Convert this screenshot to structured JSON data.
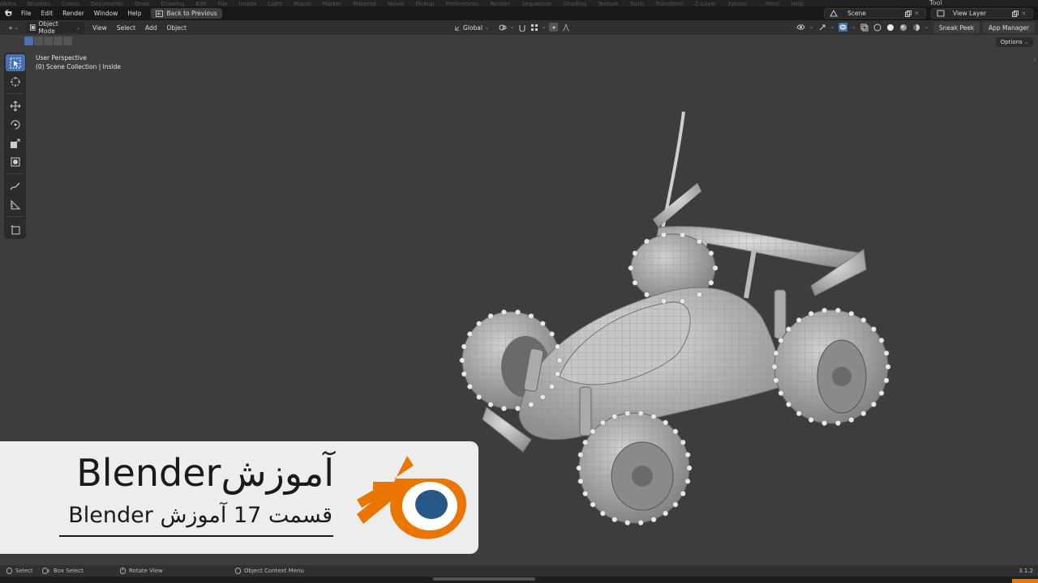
{
  "ghost_menu": [
    "Alpha",
    "Brushes",
    "Colors",
    "Documents",
    "Draw",
    "Drawing",
    "Edit",
    "File",
    "Image",
    "Light",
    "Macro",
    "Marker",
    "Material",
    "Movie",
    "Pickup",
    "Preferences",
    "Render",
    "Sequencer",
    "Shading",
    "Texture",
    "Tools",
    "Transform",
    "Z-Layer",
    "Xpress",
    "... More",
    "Help"
  ],
  "topbar": {
    "menu": [
      "File",
      "Edit",
      "Render",
      "Window",
      "Help"
    ],
    "back_label": "Back to Previous",
    "scene_label": "Scene",
    "view_layer_label": "View Layer",
    "tool_label": "Tool"
  },
  "header": {
    "mode_label": "Object Mode",
    "menu": [
      "View",
      "Select",
      "Add",
      "Object"
    ],
    "orientation_label": "Global",
    "sneak_peek_label": "Sneak Peek",
    "app_manager_label": "App Manager"
  },
  "viewport": {
    "options_label": "Options",
    "perspective_label": "User Perspective",
    "collection_label": "(0) Scene Collection | Inside"
  },
  "toolbar": {
    "tools": [
      "select-box-icon",
      "cursor-icon",
      "move-icon",
      "rotate-icon",
      "scale-icon",
      "transform-icon",
      "annotate-icon",
      "measure-icon",
      "add-cube-icon"
    ]
  },
  "banner": {
    "title": "آموزشBlender",
    "subtitle": "قسمت 17 آموزش Blender",
    "logo_colors": {
      "orange": "#ea7600",
      "blue": "#265787",
      "white": "#ffffff"
    }
  },
  "statusbar": {
    "select_label": "Select",
    "box_select_label": "Box Select",
    "rotate_view_label": "Rotate View",
    "context_menu_label": "Object Context Menu",
    "version_label": "3.1.2"
  },
  "colors": {
    "accent": "#4772b3",
    "viewport_bg": "#3d3d3d",
    "header_bg": "#303030"
  }
}
